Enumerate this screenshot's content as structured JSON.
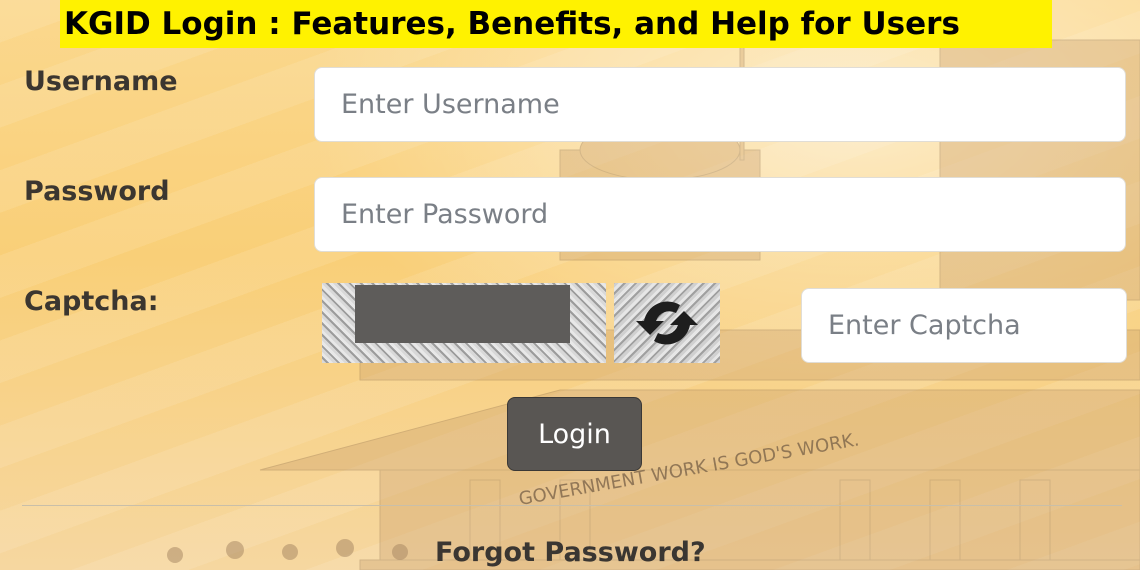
{
  "banner": {
    "title": "KGID Login : Features, Benefits, and Help for Users"
  },
  "building": {
    "motto": "GOVERNMENT WORK IS GOD'S WORK."
  },
  "form": {
    "username_label": "Username",
    "username_placeholder": "Enter Username",
    "password_label": "Password",
    "password_placeholder": "Enter Password",
    "captcha_label": "Captcha:",
    "captcha_placeholder": "Enter Captcha",
    "login_label": "Login",
    "forgot_label": "Forgot Password?"
  },
  "icons": {
    "refresh": "refresh-icon"
  },
  "colors": {
    "banner": "#fff200",
    "button": "#595653",
    "background": "#f9cf78"
  }
}
